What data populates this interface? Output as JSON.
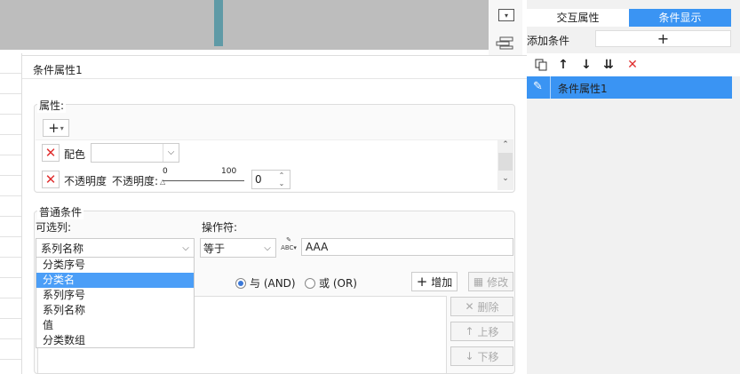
{
  "left_toolbar": {
    "icons": [
      "dropdown-box-icon",
      "layers-icon"
    ]
  },
  "dialog": {
    "title": "条件属性1",
    "properties": {
      "label": "属性:",
      "add_button": "+",
      "items": [
        {
          "name": "配色",
          "value": ""
        },
        {
          "name": "不透明度",
          "sub_label": "不透明度:",
          "slider_min": "0",
          "slider_max": "100",
          "value": "0"
        }
      ]
    },
    "conditions": {
      "label": "普通条件",
      "column_label": "可选列:",
      "operator_label": "操作符:",
      "column_value": "系列名称",
      "operator_value": "等于",
      "value_input": "AAA",
      "dropdown_options": [
        "分类序号",
        "分类名",
        "系列序号",
        "系列名称",
        "值",
        "分类数组"
      ],
      "dropdown_selected_index": 1,
      "radio_and": "与 (AND)",
      "radio_or": "或 (OR)",
      "radio_selected": "and",
      "add_button": "增加",
      "modify_button": "修改",
      "delete_button": "删除",
      "up_button": "上移",
      "down_button": "下移"
    }
  },
  "right_panel": {
    "tabs": [
      "交互属性",
      "条件显示"
    ],
    "active_tab": "条件显示",
    "add_condition_label": "添加条件",
    "add_condition_button": "+",
    "condition_items": [
      "条件属性1"
    ],
    "accent_color": "#3a94f3"
  }
}
